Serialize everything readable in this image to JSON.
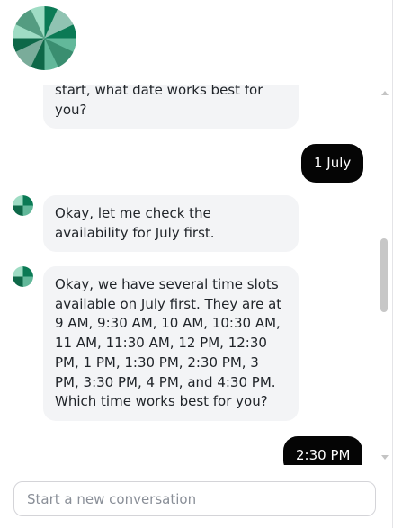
{
  "chat": {
    "composer": {
      "placeholder": "Start a new conversation"
    },
    "messages": [
      {
        "role": "bot",
        "text": "start, what date works best for you?"
      },
      {
        "role": "user",
        "text": "1 July"
      },
      {
        "role": "bot",
        "text": "Okay, let me check the availability for July first."
      },
      {
        "role": "bot",
        "text": "Okay, we have several time slots available on July first. They are at 9 AM, 9:30 AM, 10 AM, 10:30 AM, 11 AM, 11:30 AM, 12 PM, 12:30 PM, 1 PM, 1:30 PM, 2:30 PM, 3 PM, 3:30 PM, 4 PM, and 4:30 PM. Which time works best for you?"
      },
      {
        "role": "user",
        "text": "2:30 PM"
      }
    ]
  },
  "colors": {
    "bot_bubble": "#f3f4f6",
    "user_bubble": "#050505",
    "logo_primary": "#0b7a55",
    "logo_secondary": "#d9f5ea"
  },
  "icons": {
    "bot_logo": "green-pinwheel-logo",
    "bot_avatar": "green-pinwheel-avatar"
  }
}
